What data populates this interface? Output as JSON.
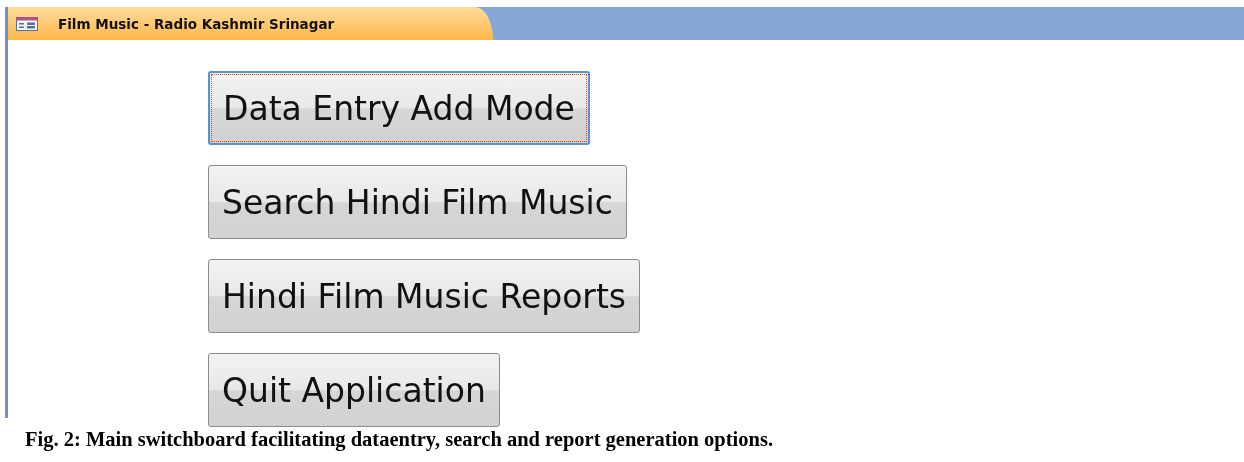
{
  "window": {
    "title": "Film Music - Radio Kashmir Srinagar"
  },
  "buttons": [
    {
      "label": "Data Entry Add Mode",
      "focused": true
    },
    {
      "label": "Search Hindi Film Music",
      "focused": false
    },
    {
      "label": "Hindi Film Music Reports",
      "focused": false
    },
    {
      "label": "Quit Application",
      "focused": false
    }
  ],
  "caption": "Fig. 2: Main switchboard facilitating dataentry, search and report generation options."
}
